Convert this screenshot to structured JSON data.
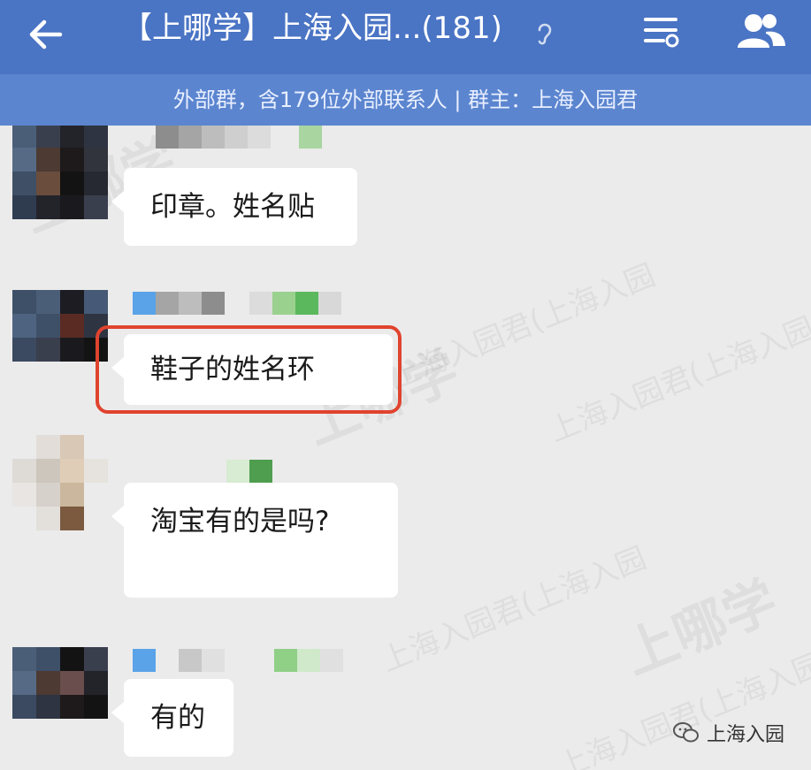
{
  "header": {
    "title": "【上哪学】上海入园...(181)",
    "subtitle": "外部群，含179位外部联系人 | 群主：上海入园君"
  },
  "messages": [
    {
      "text": "印章。姓名贴"
    },
    {
      "text": "鞋子的姓名环"
    },
    {
      "text": "淘宝有的是吗?"
    },
    {
      "text": "有的"
    }
  ],
  "watermark": {
    "brand": "上哪学",
    "account": "上海入园君(上海入园"
  },
  "footer": {
    "source": "上海入园"
  },
  "colors": {
    "header_bg": "#4a74c4",
    "subheader_bg": "#5b85cf",
    "chat_bg": "#ebebeb",
    "highlight": "#e0432e"
  }
}
